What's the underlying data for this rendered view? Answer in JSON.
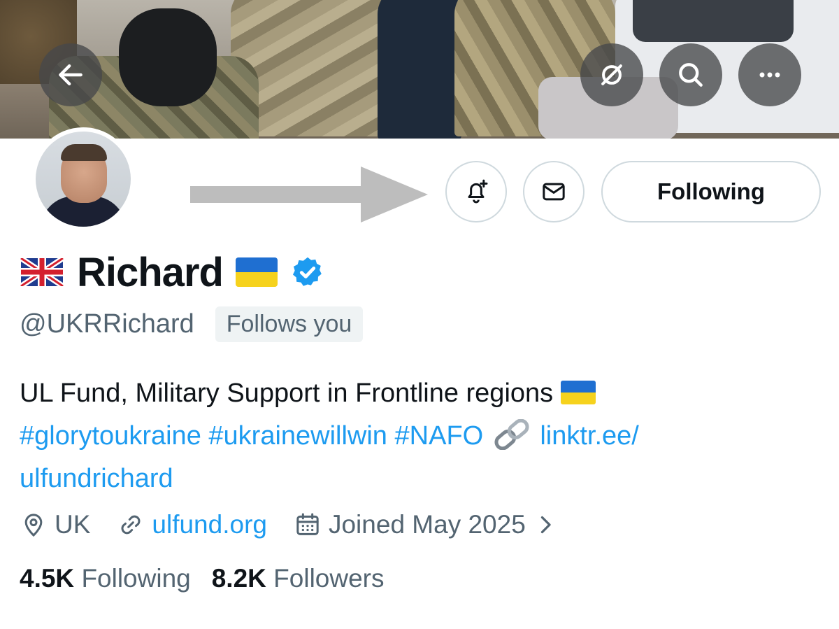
{
  "header": {
    "back_icon": "arrow-left-icon",
    "grok_icon": "grok-icon",
    "search_icon": "search-icon",
    "more_icon": "more-horizontal-icon"
  },
  "profile": {
    "display_name": "Richard",
    "prefix_emoji": "uk-flag-emoji",
    "suffix_emoji": "ukraine-flag-emoji",
    "verified": true,
    "handle": "@UKRRichard",
    "follows_you": "Follows you"
  },
  "actions": {
    "notify_icon": "bell-plus-icon",
    "message_icon": "envelope-icon",
    "following_label": "Following"
  },
  "bio": {
    "line1": "UL Fund, Military Support in Frontline regions",
    "hashtag1": "#glorytoukraine",
    "hashtag2": "#ukrainewillwin",
    "hashtag3": "#NAFO",
    "link_part1": "linktr.ee/",
    "link_part2": "ulfundrichard"
  },
  "meta": {
    "location": "UK",
    "website": "ulfund.org",
    "joined": "Joined May 2025"
  },
  "stats": {
    "following_count": "4.5K",
    "following_label": "Following",
    "followers_count": "8.2K",
    "followers_label": "Followers"
  },
  "colors": {
    "link": "#1d9bf0",
    "secondary_text": "#536471",
    "verified_badge": "#1d9bf0",
    "border": "#cfd9de"
  }
}
